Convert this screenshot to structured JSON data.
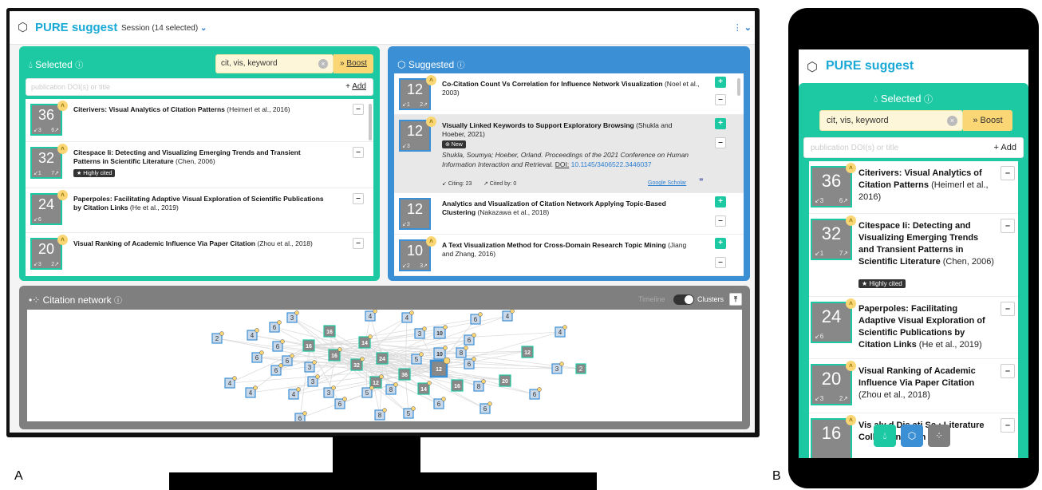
{
  "app": {
    "title": "PURE suggest",
    "session_label": "Session (14 selected)",
    "menu_label": "⋮"
  },
  "selected_panel": {
    "title": "Selected",
    "keywords": "cit, vis, keyword",
    "boost_label": "Boost",
    "doi_placeholder": "publication DOI(s) or title",
    "add_label": "Add",
    "items": [
      {
        "score": "36",
        "sub_left": "↙3",
        "sub_right": "6↗",
        "title": "Citerivers: Visual Analytics of Citation Patterns",
        "meta": "(Heimerl et al., 2016)",
        "tag": ""
      },
      {
        "score": "32",
        "sub_left": "↙1",
        "sub_right": "7↗",
        "title": "Citespace Ii: Detecting and Visualizing Emerging Trends and Transient Patterns in Scientific Literature",
        "meta": "(Chen, 2006)",
        "tag": "★ Highly cited"
      },
      {
        "score": "24",
        "sub_left": "↙6",
        "sub_right": "",
        "title": "Paperpoles: Facilitating Adaptive Visual Exploration of Scientific Publications by Citation Links",
        "meta": "(He et al., 2019)",
        "tag": ""
      },
      {
        "score": "20",
        "sub_left": "↙3",
        "sub_right": "2↗",
        "title": "Visual Ranking of Academic Influence Via Paper Citation",
        "meta": "(Zhou et al., 2018)",
        "tag": ""
      }
    ]
  },
  "suggested_panel": {
    "title": "Suggested",
    "items": [
      {
        "score": "12",
        "sub_left": "↙1",
        "sub_right": "2↗",
        "title": "Co-Citation Count Vs Correlation for Influence Network Visualization",
        "meta": "(Noel et al., 2003)"
      },
      {
        "score": "12",
        "sub_left": "↙3",
        "sub_right": "",
        "title": "Visually Linked Keywords to Support Exploratory Browsing",
        "meta": "(Shukla and Hoeber, 2021)",
        "tag": "⊚ New",
        "details": "Shukla, Soumya; Hoeber, Orland. Proceedings of the 2021 Conference on Human Information Interaction and Retrieval.",
        "doi_label": "DOI:",
        "doi": "10.1145/3406522.3446037",
        "citing": "↙ Citing: 23",
        "cited_by": "↗ Cited by: 0",
        "scholar": "Google Scholar",
        "quote": "”"
      },
      {
        "score": "12",
        "sub_left": "↙3",
        "sub_right": "",
        "title": "Analytics and Visualization of Citation Network Applying Topic-Based Clustering",
        "meta": "(Nakazawa et al., 2018)"
      },
      {
        "score": "10",
        "sub_left": "↙2",
        "sub_right": "3↗",
        "title": "A Text Visualization Method for Cross-Domain Research Topic Mining",
        "meta": "(Jiang and Zhang, 2016)"
      }
    ]
  },
  "network_panel": {
    "title": "Citation network",
    "timeline_label": "Timeline",
    "clusters_label": "Clusters",
    "nodes": [
      {
        "label": "3",
        "kind": "sug"
      },
      {
        "label": "6",
        "kind": "sug"
      },
      {
        "label": "4",
        "kind": "sug"
      },
      {
        "label": "4",
        "kind": "sug"
      },
      {
        "label": "6",
        "kind": "sug"
      },
      {
        "label": "4",
        "kind": "sug"
      },
      {
        "label": "2",
        "kind": "sug"
      },
      {
        "label": "4",
        "kind": "sug"
      },
      {
        "label": "6",
        "kind": "sug"
      },
      {
        "label": "16",
        "kind": "sel"
      },
      {
        "label": "3",
        "kind": "sug"
      },
      {
        "label": "10",
        "kind": "sug"
      },
      {
        "label": "6",
        "kind": "sug"
      },
      {
        "label": "4",
        "kind": "sug"
      },
      {
        "label": "14",
        "kind": "sel"
      },
      {
        "label": "6",
        "kind": "sug"
      },
      {
        "label": "6",
        "kind": "sug"
      },
      {
        "label": "16",
        "kind": "sel"
      },
      {
        "label": "16",
        "kind": "sel"
      },
      {
        "label": "10",
        "kind": "sug"
      },
      {
        "label": "8",
        "kind": "sug"
      },
      {
        "label": "12",
        "kind": "sel"
      },
      {
        "label": "3",
        "kind": "sug"
      },
      {
        "label": "6",
        "kind": "sug"
      },
      {
        "label": "32",
        "kind": "sel"
      },
      {
        "label": "24",
        "kind": "sel"
      },
      {
        "label": "5",
        "kind": "sug"
      },
      {
        "label": "12",
        "kind": "focus"
      },
      {
        "label": "6",
        "kind": "sug"
      },
      {
        "label": "36",
        "kind": "sel"
      },
      {
        "label": "12",
        "kind": "sel"
      },
      {
        "label": "4",
        "kind": "sug"
      },
      {
        "label": "3",
        "kind": "sug"
      },
      {
        "label": "3",
        "kind": "sug"
      },
      {
        "label": "4",
        "kind": "sug"
      },
      {
        "label": "8",
        "kind": "sug"
      },
      {
        "label": "14",
        "kind": "sel"
      },
      {
        "label": "16",
        "kind": "sel"
      },
      {
        "label": "8",
        "kind": "sug"
      },
      {
        "label": "20",
        "kind": "sel"
      },
      {
        "label": "3",
        "kind": "sug"
      },
      {
        "label": "2",
        "kind": "sel"
      },
      {
        "label": "4",
        "kind": "sug"
      },
      {
        "label": "6",
        "kind": "sug"
      },
      {
        "label": "5",
        "kind": "sug"
      },
      {
        "label": "6",
        "kind": "sug"
      },
      {
        "label": "6",
        "kind": "sug"
      },
      {
        "label": "8",
        "kind": "sug"
      },
      {
        "label": "5",
        "kind": "sug"
      },
      {
        "label": "6",
        "kind": "sug"
      },
      {
        "label": "6",
        "kind": "sug"
      }
    ]
  },
  "phone": {
    "title": "PURE suggest",
    "panel_title": "Selected",
    "keywords": "cit, vis, keyword",
    "boost_label": "Boost",
    "doi_placeholder": "publication DOI(s) or title",
    "add_label": "Add",
    "items": [
      {
        "score": "36",
        "sub_left": "↙3",
        "sub_right": "6↗",
        "title": "Citerivers: Visual Analytics of Citation Patterns",
        "meta": "(Heimerl et al., 2016)",
        "tag": ""
      },
      {
        "score": "32",
        "sub_left": "↙1",
        "sub_right": "7↗",
        "title": "Citespace Ii: Detecting and Visualizing Emerging Trends and Transient Patterns in Scientific Literature",
        "meta": "(Chen, 2006)",
        "tag": "★ Highly cited"
      },
      {
        "score": "24",
        "sub_left": "↙6",
        "sub_right": "",
        "title": "Paperpoles: Facilitating Adaptive Visual Exploration of Scientific Publications by Citation Links",
        "meta": "(He et al., 2019)",
        "tag": ""
      },
      {
        "score": "20",
        "sub_left": "↙3",
        "sub_right": "2↗",
        "title": "Visual Ranking of Academic Influence Via Paper Citation",
        "meta": "(Zhou et al., 2018)",
        "tag": ""
      },
      {
        "score": "16",
        "sub_left": "",
        "sub_right": "",
        "title": "Vis aly d Dis ati Sc : Literature Collections with",
        "meta": "",
        "tag": ""
      }
    ]
  },
  "figure_labels": {
    "a": "A",
    "b": "B"
  },
  "colors": {
    "green": "#1dc9a3",
    "blue": "#3b8fd4",
    "gray": "#7f7f7f",
    "yellow": "#fbd675",
    "brand": "#1aa9d6"
  }
}
